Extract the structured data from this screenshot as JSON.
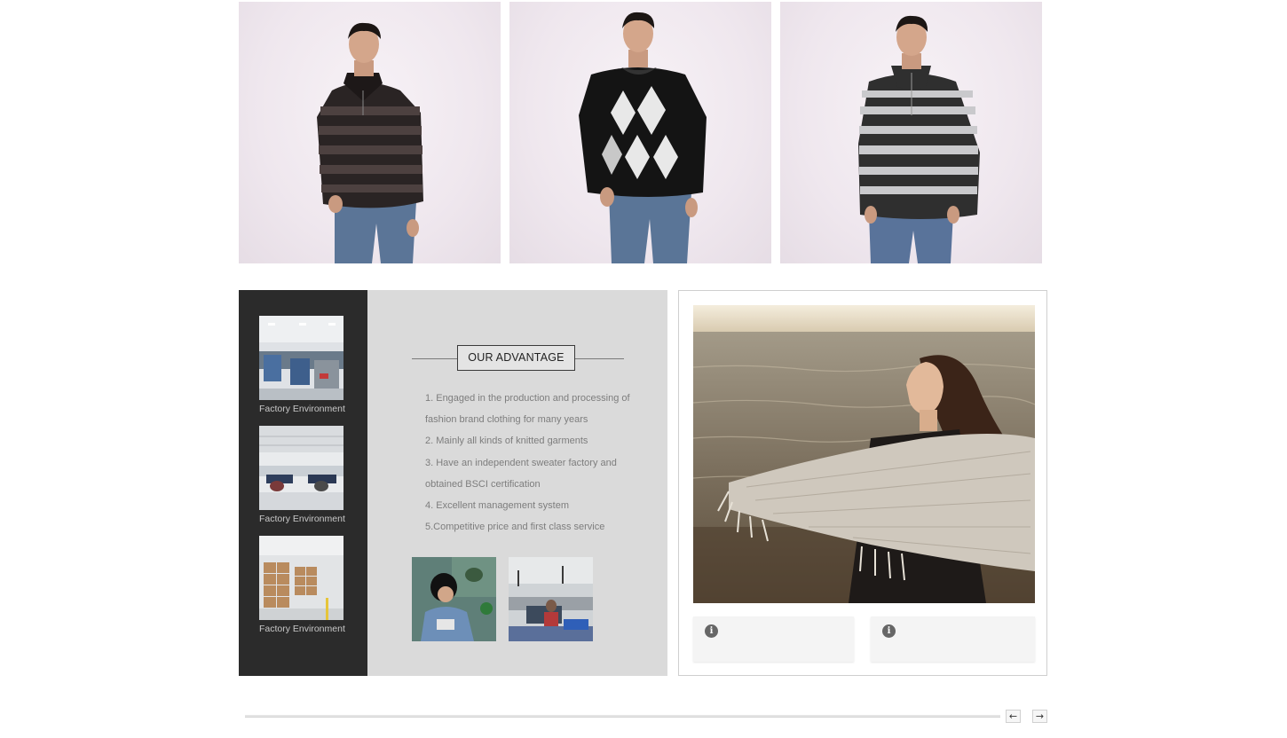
{
  "products": [
    {
      "name": "striped-zip-sweater",
      "sweater_color": "#2a2424",
      "stripe_color": "#5a4c4a"
    },
    {
      "name": "argyle-crewneck-sweater",
      "sweater_color": "#141414",
      "stripe_color": "#e8e8e8"
    },
    {
      "name": "grey-striped-zip-sweater",
      "sweater_color": "#3a3a3a",
      "stripe_color": "#c9c9cc"
    }
  ],
  "factory_rail": {
    "items": [
      {
        "caption": "Factory Environment"
      },
      {
        "caption": "Factory Environment"
      },
      {
        "caption": "Factory Environment"
      }
    ]
  },
  "advantage": {
    "title": "OUR ADVANTAGE",
    "points": [
      "1. Engaged in the production and processing of fashion brand clothing for many years",
      "2. Mainly all kinds of knitted garments",
      "3. Have an independent sweater factory and obtained BSCI certification",
      "4. Excellent management system",
      "5.Competitive price and first class service"
    ]
  },
  "feature": {
    "info_icon_glyph": "i"
  },
  "pager": {
    "prev_label": "←",
    "next_label": "→"
  },
  "colors": {
    "rail_bg": "#2b2b2b",
    "panel_bg": "#dadada",
    "text_muted": "#7d7d7d"
  }
}
